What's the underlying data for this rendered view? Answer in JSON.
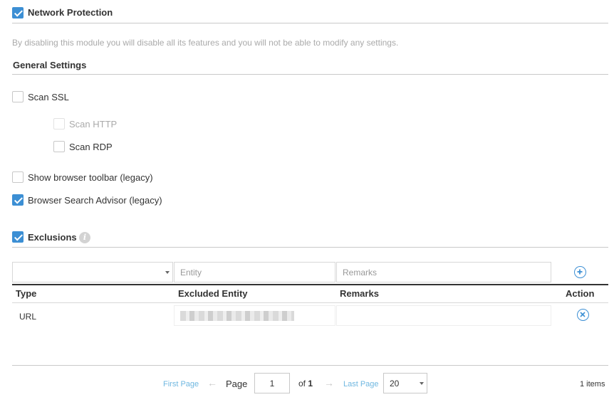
{
  "network_protection": {
    "label": "Network Protection",
    "checked": true,
    "note": "By disabling this module you will disable all its features and you will not be able to modify any settings."
  },
  "general": {
    "title": "General Settings",
    "scan_ssl": {
      "label": "Scan SSL",
      "checked": false
    },
    "scan_http": {
      "label": "Scan HTTP",
      "checked": false,
      "disabled": true
    },
    "scan_rdp": {
      "label": "Scan RDP",
      "checked": false
    },
    "show_toolbar": {
      "label": "Show browser toolbar (legacy)",
      "checked": false
    },
    "search_advisor": {
      "label": "Browser Search Advisor (legacy)",
      "checked": true
    }
  },
  "exclusions": {
    "label": "Exclusions",
    "checked": true,
    "info_icon": "info-icon",
    "add_form": {
      "type_value": "",
      "entity_placeholder": "Entity",
      "remarks_placeholder": "Remarks",
      "add_icon": "plus-circle-icon"
    },
    "columns": {
      "type": "Type",
      "entity": "Excluded Entity",
      "remarks": "Remarks",
      "action": "Action"
    },
    "rows": [
      {
        "type": "URL",
        "entity": "",
        "remarks": "",
        "action_icon": "remove-circle-icon"
      }
    ]
  },
  "pagination": {
    "first_page": "First Page",
    "page_label": "Page",
    "page_value": "1",
    "of_label": "of",
    "total_pages": "1",
    "last_page": "Last Page",
    "page_size": "20",
    "items_count": "1 items"
  },
  "colors": {
    "accent": "#3c8fd4",
    "link": "#6fb7e0",
    "rule": "#c9c9c9"
  }
}
